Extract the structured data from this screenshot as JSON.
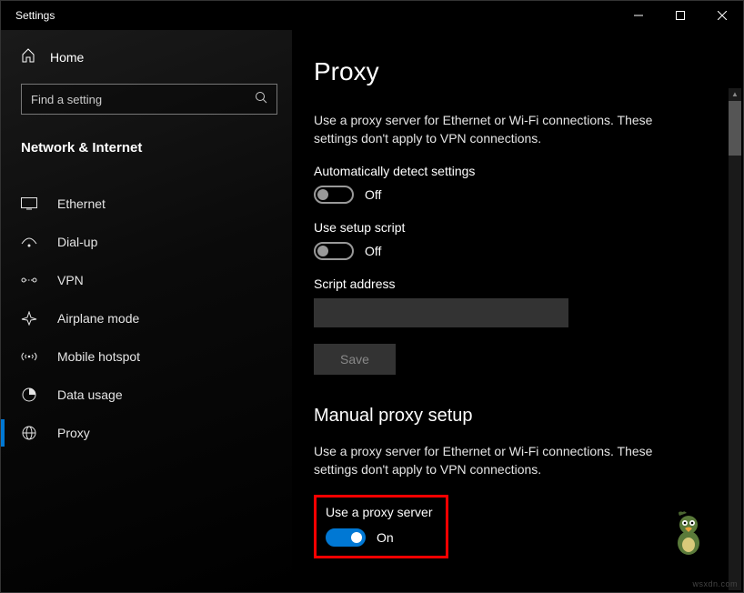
{
  "window": {
    "title": "Settings"
  },
  "sidebar": {
    "home": "Home",
    "search_placeholder": "Find a setting",
    "section": "Network & Internet",
    "items": [
      {
        "label": "Ethernet"
      },
      {
        "label": "Dial-up"
      },
      {
        "label": "VPN"
      },
      {
        "label": "Airplane mode"
      },
      {
        "label": "Mobile hotspot"
      },
      {
        "label": "Data usage"
      },
      {
        "label": "Proxy"
      }
    ]
  },
  "main": {
    "title": "Proxy",
    "desc1": "Use a proxy server for Ethernet or Wi-Fi connections. These settings don't apply to VPN connections.",
    "auto_detect_label": "Automatically detect settings",
    "auto_detect_state": "Off",
    "setup_script_label": "Use setup script",
    "setup_script_state": "Off",
    "script_address_label": "Script address",
    "script_address_value": "",
    "save_label": "Save",
    "manual_title": "Manual proxy setup",
    "desc2": "Use a proxy server for Ethernet or Wi-Fi connections. These settings don't apply to VPN connections.",
    "use_proxy_label": "Use a proxy server",
    "use_proxy_state": "On"
  },
  "watermark": "wsxdn.com"
}
